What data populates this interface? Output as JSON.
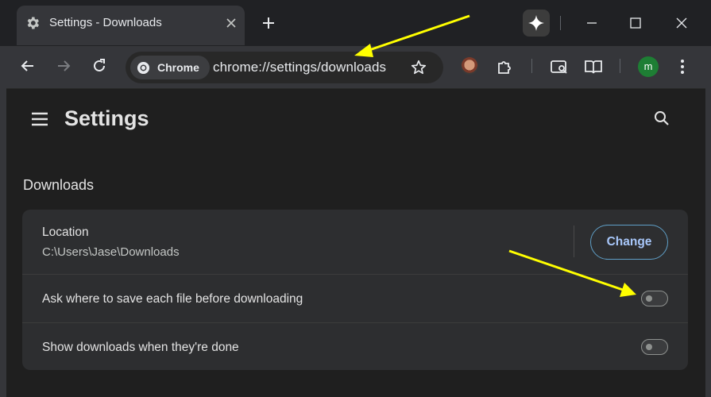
{
  "tab": {
    "title": "Settings - Downloads"
  },
  "omnibox": {
    "chip_label": "Chrome",
    "url": "chrome://settings/downloads"
  },
  "avatar": {
    "initial": "m",
    "color": "#1e7e34"
  },
  "page": {
    "title": "Settings",
    "section": "Downloads"
  },
  "location": {
    "label": "Location",
    "path": "C:\\Users\\Jase\\Downloads",
    "change_label": "Change"
  },
  "ask_where": {
    "label": "Ask where to save each file before downloading",
    "enabled": false
  },
  "show_downloads": {
    "label": "Show downloads when they're done",
    "enabled": false
  },
  "annotations": {
    "arrow_color": "#ffff00"
  },
  "icons": [
    "gear-icon",
    "close-icon",
    "plus-icon",
    "sparkle-icon",
    "minimize-icon",
    "maximize-icon",
    "back-icon",
    "forward-icon",
    "reload-icon",
    "chrome-logo-icon",
    "star-icon",
    "extension-icon",
    "puzzle-icon",
    "search-tabs-icon",
    "reading-mode-icon",
    "more-vert-icon",
    "menu-icon",
    "search-icon"
  ]
}
